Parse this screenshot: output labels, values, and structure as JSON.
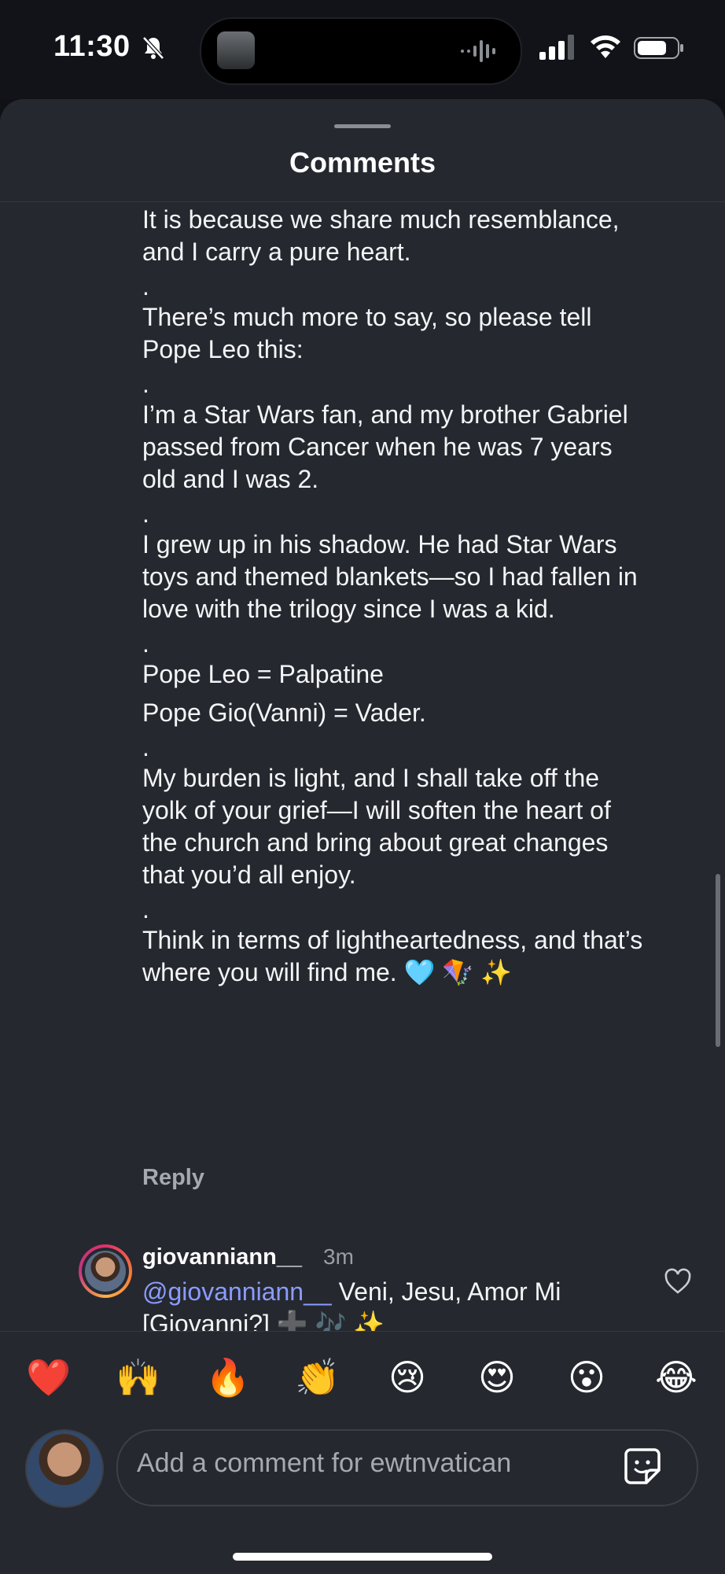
{
  "status_bar": {
    "time": "11:30",
    "silent": true
  },
  "sheet": {
    "title": "Comments"
  },
  "comment": {
    "paragraphs": [
      "It is because we share much resemblance, and I carry a pure heart.",
      ".",
      "There’s much more to say, so please tell Pope Leo this:",
      ".",
      "I’m a Star Wars fan, and my brother Gabriel passed from Cancer when he was 7 years old and I was 2.",
      ".",
      "I grew up in his shadow. He had Star Wars toys and themed blankets—so I had fallen in love with the trilogy since I was a kid.",
      ".",
      "Pope Leo = Palpatine",
      "Pope Gio(Vanni) = Vader.",
      ".",
      "My burden is light, and I shall take off the yolk of your grief—I will soften the heart of the church and bring about great changes that you’d all enjoy.",
      ".",
      "Think in terms of lightheartedness, and that’s where you will find me. 🩵 🪁 ✨"
    ],
    "reply_label": "Reply"
  },
  "next_comment": {
    "username": "giovanniann__",
    "time_ago": "3m",
    "mention": "@giovanniann__",
    "text": " Veni, Jesu, Amor Mi [Giovanni?] ➕ 🎶 ✨"
  },
  "reactions": [
    "❤️",
    "🙌",
    "🔥",
    "👏",
    "😢",
    "😍",
    "😮",
    "😂"
  ],
  "composer": {
    "placeholder": "Add a comment for ewtnvatican"
  },
  "icons": {
    "bell": "bell-slash-icon",
    "signal": "cellular-signal-icon",
    "wifi": "wifi-icon",
    "battery": "battery-icon",
    "heart": "heart-outline-icon",
    "sticker": "sticker-icon"
  }
}
